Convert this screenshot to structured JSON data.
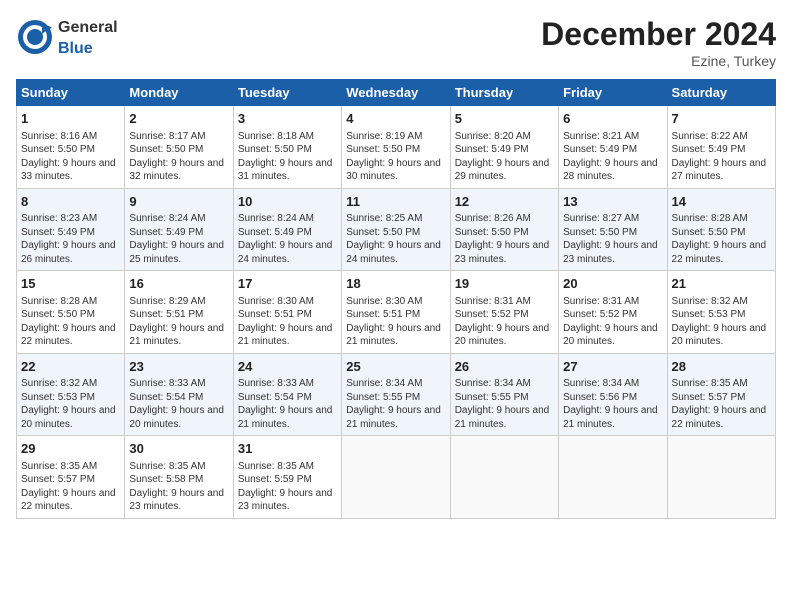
{
  "header": {
    "logo_general": "General",
    "logo_blue": "Blue",
    "month": "December 2024",
    "location": "Ezine, Turkey"
  },
  "weekdays": [
    "Sunday",
    "Monday",
    "Tuesday",
    "Wednesday",
    "Thursday",
    "Friday",
    "Saturday"
  ],
  "weeks": [
    [
      {
        "day": "1",
        "sunrise": "Sunrise: 8:16 AM",
        "sunset": "Sunset: 5:50 PM",
        "daylight": "Daylight: 9 hours and 33 minutes."
      },
      {
        "day": "2",
        "sunrise": "Sunrise: 8:17 AM",
        "sunset": "Sunset: 5:50 PM",
        "daylight": "Daylight: 9 hours and 32 minutes."
      },
      {
        "day": "3",
        "sunrise": "Sunrise: 8:18 AM",
        "sunset": "Sunset: 5:50 PM",
        "daylight": "Daylight: 9 hours and 31 minutes."
      },
      {
        "day": "4",
        "sunrise": "Sunrise: 8:19 AM",
        "sunset": "Sunset: 5:50 PM",
        "daylight": "Daylight: 9 hours and 30 minutes."
      },
      {
        "day": "5",
        "sunrise": "Sunrise: 8:20 AM",
        "sunset": "Sunset: 5:49 PM",
        "daylight": "Daylight: 9 hours and 29 minutes."
      },
      {
        "day": "6",
        "sunrise": "Sunrise: 8:21 AM",
        "sunset": "Sunset: 5:49 PM",
        "daylight": "Daylight: 9 hours and 28 minutes."
      },
      {
        "day": "7",
        "sunrise": "Sunrise: 8:22 AM",
        "sunset": "Sunset: 5:49 PM",
        "daylight": "Daylight: 9 hours and 27 minutes."
      }
    ],
    [
      {
        "day": "8",
        "sunrise": "Sunrise: 8:23 AM",
        "sunset": "Sunset: 5:49 PM",
        "daylight": "Daylight: 9 hours and 26 minutes."
      },
      {
        "day": "9",
        "sunrise": "Sunrise: 8:24 AM",
        "sunset": "Sunset: 5:49 PM",
        "daylight": "Daylight: 9 hours and 25 minutes."
      },
      {
        "day": "10",
        "sunrise": "Sunrise: 8:24 AM",
        "sunset": "Sunset: 5:49 PM",
        "daylight": "Daylight: 9 hours and 24 minutes."
      },
      {
        "day": "11",
        "sunrise": "Sunrise: 8:25 AM",
        "sunset": "Sunset: 5:50 PM",
        "daylight": "Daylight: 9 hours and 24 minutes."
      },
      {
        "day": "12",
        "sunrise": "Sunrise: 8:26 AM",
        "sunset": "Sunset: 5:50 PM",
        "daylight": "Daylight: 9 hours and 23 minutes."
      },
      {
        "day": "13",
        "sunrise": "Sunrise: 8:27 AM",
        "sunset": "Sunset: 5:50 PM",
        "daylight": "Daylight: 9 hours and 23 minutes."
      },
      {
        "day": "14",
        "sunrise": "Sunrise: 8:28 AM",
        "sunset": "Sunset: 5:50 PM",
        "daylight": "Daylight: 9 hours and 22 minutes."
      }
    ],
    [
      {
        "day": "15",
        "sunrise": "Sunrise: 8:28 AM",
        "sunset": "Sunset: 5:50 PM",
        "daylight": "Daylight: 9 hours and 22 minutes."
      },
      {
        "day": "16",
        "sunrise": "Sunrise: 8:29 AM",
        "sunset": "Sunset: 5:51 PM",
        "daylight": "Daylight: 9 hours and 21 minutes."
      },
      {
        "day": "17",
        "sunrise": "Sunrise: 8:30 AM",
        "sunset": "Sunset: 5:51 PM",
        "daylight": "Daylight: 9 hours and 21 minutes."
      },
      {
        "day": "18",
        "sunrise": "Sunrise: 8:30 AM",
        "sunset": "Sunset: 5:51 PM",
        "daylight": "Daylight: 9 hours and 21 minutes."
      },
      {
        "day": "19",
        "sunrise": "Sunrise: 8:31 AM",
        "sunset": "Sunset: 5:52 PM",
        "daylight": "Daylight: 9 hours and 20 minutes."
      },
      {
        "day": "20",
        "sunrise": "Sunrise: 8:31 AM",
        "sunset": "Sunset: 5:52 PM",
        "daylight": "Daylight: 9 hours and 20 minutes."
      },
      {
        "day": "21",
        "sunrise": "Sunrise: 8:32 AM",
        "sunset": "Sunset: 5:53 PM",
        "daylight": "Daylight: 9 hours and 20 minutes."
      }
    ],
    [
      {
        "day": "22",
        "sunrise": "Sunrise: 8:32 AM",
        "sunset": "Sunset: 5:53 PM",
        "daylight": "Daylight: 9 hours and 20 minutes."
      },
      {
        "day": "23",
        "sunrise": "Sunrise: 8:33 AM",
        "sunset": "Sunset: 5:54 PM",
        "daylight": "Daylight: 9 hours and 20 minutes."
      },
      {
        "day": "24",
        "sunrise": "Sunrise: 8:33 AM",
        "sunset": "Sunset: 5:54 PM",
        "daylight": "Daylight: 9 hours and 21 minutes."
      },
      {
        "day": "25",
        "sunrise": "Sunrise: 8:34 AM",
        "sunset": "Sunset: 5:55 PM",
        "daylight": "Daylight: 9 hours and 21 minutes."
      },
      {
        "day": "26",
        "sunrise": "Sunrise: 8:34 AM",
        "sunset": "Sunset: 5:55 PM",
        "daylight": "Daylight: 9 hours and 21 minutes."
      },
      {
        "day": "27",
        "sunrise": "Sunrise: 8:34 AM",
        "sunset": "Sunset: 5:56 PM",
        "daylight": "Daylight: 9 hours and 21 minutes."
      },
      {
        "day": "28",
        "sunrise": "Sunrise: 8:35 AM",
        "sunset": "Sunset: 5:57 PM",
        "daylight": "Daylight: 9 hours and 22 minutes."
      }
    ],
    [
      {
        "day": "29",
        "sunrise": "Sunrise: 8:35 AM",
        "sunset": "Sunset: 5:57 PM",
        "daylight": "Daylight: 9 hours and 22 minutes."
      },
      {
        "day": "30",
        "sunrise": "Sunrise: 8:35 AM",
        "sunset": "Sunset: 5:58 PM",
        "daylight": "Daylight: 9 hours and 23 minutes."
      },
      {
        "day": "31",
        "sunrise": "Sunrise: 8:35 AM",
        "sunset": "Sunset: 5:59 PM",
        "daylight": "Daylight: 9 hours and 23 minutes."
      },
      null,
      null,
      null,
      null
    ]
  ]
}
